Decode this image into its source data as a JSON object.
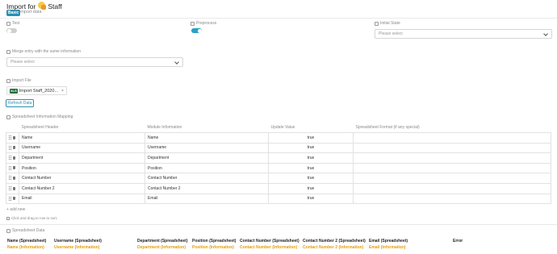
{
  "header": {
    "title_prefix": "Import for",
    "module_name": "Staff",
    "badge": "Basic",
    "subtitle": "import data"
  },
  "options": {
    "test_label": "Test",
    "test_on": false,
    "preprocess_label": "Preprocess",
    "preprocess_on": true,
    "initial_state_label": "Initial State",
    "initial_state_placeholder": "Please select",
    "merge_label": "Merge entry with the same information",
    "merge_placeholder": "Please select"
  },
  "import_file": {
    "label": "Import File",
    "file_type": "XLS",
    "file_name": "Import Staff_2020...",
    "close": "×",
    "refresh_label": "Refresh Data"
  },
  "mapping": {
    "label": "Spreadsheet Information Mapping",
    "columns": [
      "Spreadsheet Header",
      "Module Information",
      "Update Value",
      "Spreadsheet Format (if any special)"
    ],
    "rows": [
      {
        "header": "Name",
        "module": "Name",
        "update": "true",
        "format": ""
      },
      {
        "header": "Username",
        "module": "Username",
        "update": "true",
        "format": ""
      },
      {
        "header": "Department",
        "module": "Department",
        "update": "true",
        "format": ""
      },
      {
        "header": "Position",
        "module": "Position",
        "update": "true",
        "format": ""
      },
      {
        "header": "Contact Number",
        "module": "Contact Number",
        "update": "true",
        "format": ""
      },
      {
        "header": "Contact Number 2",
        "module": "Contact Number 2",
        "update": "true",
        "format": ""
      },
      {
        "header": "Email",
        "module": "Email",
        "update": "true",
        "format": ""
      }
    ],
    "add_new": "+ add new",
    "hint": "Click and drag to row to sort."
  },
  "spreadsheet_data": {
    "label": "Spreadsheet Data",
    "headers": [
      "Name (Spreadsheet)",
      "Username (Spreadsheet)",
      "Department (Spreadsheet)",
      "Position (Spreadsheet)",
      "Contact Number (Spreadsheet)",
      "Contact Number 2 (Spreadsheet)",
      "Email (Spreadsheet)",
      "Error"
    ],
    "values": [
      "Name (Information)",
      "Username (Information)",
      "Department (Information)",
      "Position (Information)",
      "Contact Number (Information)",
      "Contact Number 2 (Information)",
      "Email (Information)",
      ""
    ]
  },
  "colors": {
    "accent": "#2d8fb2",
    "toggle_on": "#2ba0c8",
    "highlight": "#e59c0c"
  }
}
